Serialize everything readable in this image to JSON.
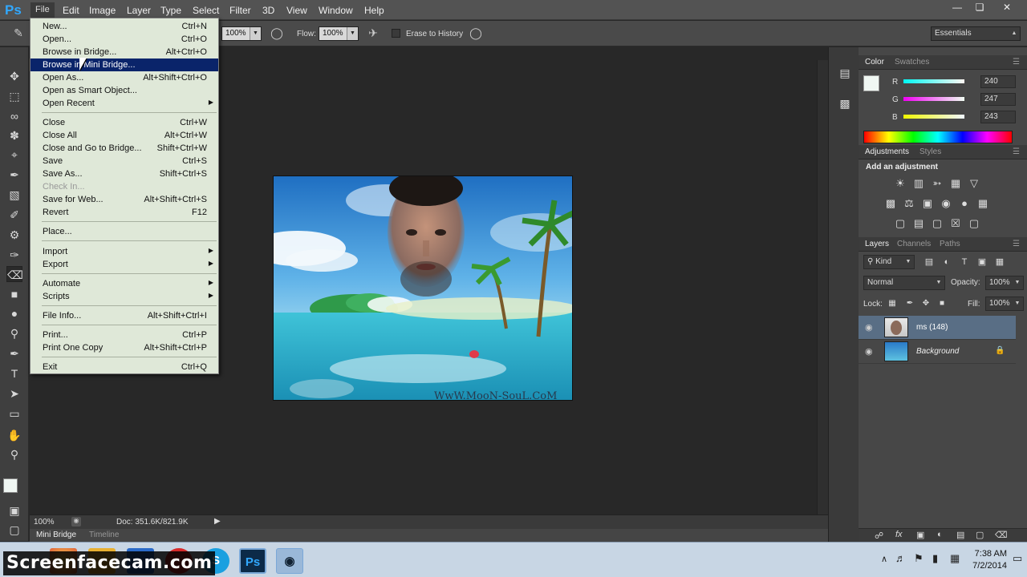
{
  "app": {
    "logo": "Ps"
  },
  "menubar": {
    "items": [
      "File",
      "Edit",
      "Image",
      "Layer",
      "Type",
      "Select",
      "Filter",
      "3D",
      "View",
      "Window",
      "Help"
    ],
    "window_controls": [
      "minimize",
      "restore",
      "close"
    ]
  },
  "options_bar": {
    "opacity_value": "100%",
    "flow_label": "Flow:",
    "flow_value": "100%",
    "erase_to_history_label": "Erase to History",
    "workspace": "Essentials"
  },
  "file_menu": {
    "items": [
      {
        "label": "New...",
        "shortcut": "Ctrl+N"
      },
      {
        "label": "Open...",
        "shortcut": "Ctrl+O"
      },
      {
        "label": "Browse in Bridge...",
        "shortcut": "Alt+Ctrl+O"
      },
      {
        "label": "Browse in Mini Bridge...",
        "shortcut": ""
      },
      {
        "label": "Open As...",
        "shortcut": "Alt+Shift+Ctrl+O"
      },
      {
        "label": "Open as Smart Object...",
        "shortcut": ""
      },
      {
        "label": "Open Recent",
        "shortcut": ""
      },
      {
        "label": "Close",
        "shortcut": "Ctrl+W"
      },
      {
        "label": "Close All",
        "shortcut": "Alt+Ctrl+W"
      },
      {
        "label": "Close and Go to Bridge...",
        "shortcut": "Shift+Ctrl+W"
      },
      {
        "label": "Save",
        "shortcut": "Ctrl+S"
      },
      {
        "label": "Save As...",
        "shortcut": "Shift+Ctrl+S"
      },
      {
        "label": "Check In...",
        "shortcut": ""
      },
      {
        "label": "Save for Web...",
        "shortcut": "Alt+Shift+Ctrl+S"
      },
      {
        "label": "Revert",
        "shortcut": "F12"
      },
      {
        "label": "Place...",
        "shortcut": ""
      },
      {
        "label": "Import",
        "shortcut": ""
      },
      {
        "label": "Export",
        "shortcut": ""
      },
      {
        "label": "Automate",
        "shortcut": ""
      },
      {
        "label": "Scripts",
        "shortcut": ""
      },
      {
        "label": "File Info...",
        "shortcut": "Alt+Shift+Ctrl+I"
      },
      {
        "label": "Print...",
        "shortcut": "Ctrl+P"
      },
      {
        "label": "Print One Copy",
        "shortcut": "Alt+Shift+Ctrl+P"
      },
      {
        "label": "Exit",
        "shortcut": "Ctrl+Q"
      }
    ]
  },
  "document": {
    "watermark_text": "WwW.MooN-SouL.CoM"
  },
  "status_bar": {
    "zoom": "100%",
    "doc_info": "Doc: 351.6K/821.9K"
  },
  "bottom_tabs": [
    "Mini Bridge",
    "Timeline"
  ],
  "color_panel": {
    "tabs": [
      "Color",
      "Swatches"
    ],
    "r_label": "R",
    "g_label": "G",
    "b_label": "B",
    "r": "240",
    "g": "247",
    "b": "243"
  },
  "adjustments_panel": {
    "tabs": [
      "Adjustments",
      "Styles"
    ],
    "heading": "Add an adjustment"
  },
  "layers_panel": {
    "tabs": [
      "Layers",
      "Channels",
      "Paths"
    ],
    "filter_kind": "Kind",
    "blend_mode": "Normal",
    "opacity_label": "Opacity:",
    "opacity": "100%",
    "lock_label": "Lock:",
    "fill_label": "Fill:",
    "fill": "100%",
    "layers": [
      {
        "name": "ms (148)"
      },
      {
        "name": "Background"
      }
    ]
  },
  "taskbar": {
    "watermark": "Screenfacecam.com",
    "time": "7:38 AM",
    "date": "7/2/2014"
  },
  "colors": {
    "ps_blue": "#31a8ff",
    "menu_highlight": "#0a246a",
    "menu_bg": "#dfe8d8"
  }
}
